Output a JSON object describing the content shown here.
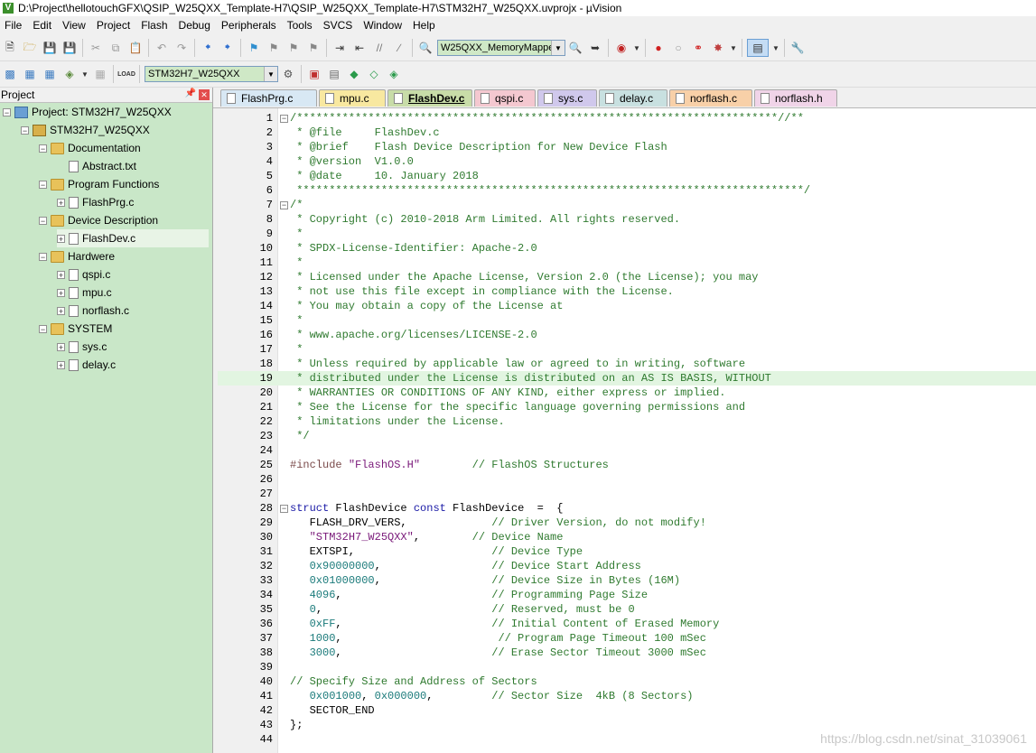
{
  "window": {
    "title": "D:\\Project\\hellotouchGFX\\QSIP_W25QXX_Template-H7\\QSIP_W25QXX_Template-H7\\STM32H7_W25QXX.uvprojx - µVision"
  },
  "menu": [
    "File",
    "Edit",
    "View",
    "Project",
    "Flash",
    "Debug",
    "Peripherals",
    "Tools",
    "SVCS",
    "Window",
    "Help"
  ],
  "toolbar": {
    "config_combo": "W25QXX_MemoryMappe",
    "target_combo": "STM32H7_W25QXX"
  },
  "project_pane": {
    "title": "Project",
    "root": "Project: STM32H7_W25QXX",
    "target": "STM32H7_W25QXX",
    "groups": [
      {
        "name": "Documentation",
        "files": [
          "Abstract.txt"
        ]
      },
      {
        "name": "Program Functions",
        "files": [
          "FlashPrg.c"
        ]
      },
      {
        "name": "Device Description",
        "files": [
          "FlashDev.c"
        ]
      },
      {
        "name": "Hardwere",
        "files": [
          "qspi.c",
          "mpu.c",
          "norflash.c"
        ]
      },
      {
        "name": "SYSTEM",
        "files": [
          "sys.c",
          "delay.c"
        ]
      }
    ]
  },
  "tabs": [
    {
      "label": "FlashPrg.c",
      "color": "#d8e8f4"
    },
    {
      "label": "mpu.c",
      "color": "#f8e8a0"
    },
    {
      "label": "FlashDev.c",
      "color": "#c8dca8"
    },
    {
      "label": "qspi.c",
      "color": "#f4c8d0"
    },
    {
      "label": "sys.c",
      "color": "#d0c8ec"
    },
    {
      "label": "delay.c",
      "color": "#c8e0e0"
    },
    {
      "label": "norflash.c",
      "color": "#f8d0a8"
    },
    {
      "label": "norflash.h",
      "color": "#f0d4e8"
    }
  ],
  "editor": {
    "highlight_line": 19,
    "lines": [
      "/**************************************************************************//**",
      " * @file     FlashDev.c",
      " * @brief    Flash Device Description for New Device Flash",
      " * @version  V1.0.0",
      " * @date     10. January 2018",
      " ******************************************************************************/",
      "/*",
      " * Copyright (c) 2010-2018 Arm Limited. All rights reserved.",
      " *",
      " * SPDX-License-Identifier: Apache-2.0",
      " *",
      " * Licensed under the Apache License, Version 2.0 (the License); you may",
      " * not use this file except in compliance with the License.",
      " * You may obtain a copy of the License at",
      " *",
      " * www.apache.org/licenses/LICENSE-2.0",
      " *",
      " * Unless required by applicable law or agreed to in writing, software",
      " * distributed under the License is distributed on an AS IS BASIS, WITHOUT",
      " * WARRANTIES OR CONDITIONS OF ANY KIND, either express or implied.",
      " * See the License for the specific language governing permissions and",
      " * limitations under the License.",
      " */",
      "",
      "#include \"FlashOS.H\"        // FlashOS Structures",
      "",
      "",
      "struct FlashDevice const FlashDevice  =  {",
      "   FLASH_DRV_VERS,             // Driver Version, do not modify!",
      "   \"STM32H7_W25QXX\",        // Device Name",
      "   EXTSPI,                     // Device Type",
      "   0x90000000,                 // Device Start Address",
      "   0x01000000,                 // Device Size in Bytes (16M)",
      "   4096,                       // Programming Page Size",
      "   0,                          // Reserved, must be 0",
      "   0xFF,                       // Initial Content of Erased Memory",
      "   1000,                        // Program Page Timeout 100 mSec",
      "   3000,                       // Erase Sector Timeout 3000 mSec",
      "",
      "// Specify Size and Address of Sectors",
      "   0x001000, 0x000000,         // Sector Size  4kB (8 Sectors)",
      "   SECTOR_END",
      "};",
      ""
    ]
  },
  "watermark": "https://blog.csdn.net/sinat_31039061"
}
